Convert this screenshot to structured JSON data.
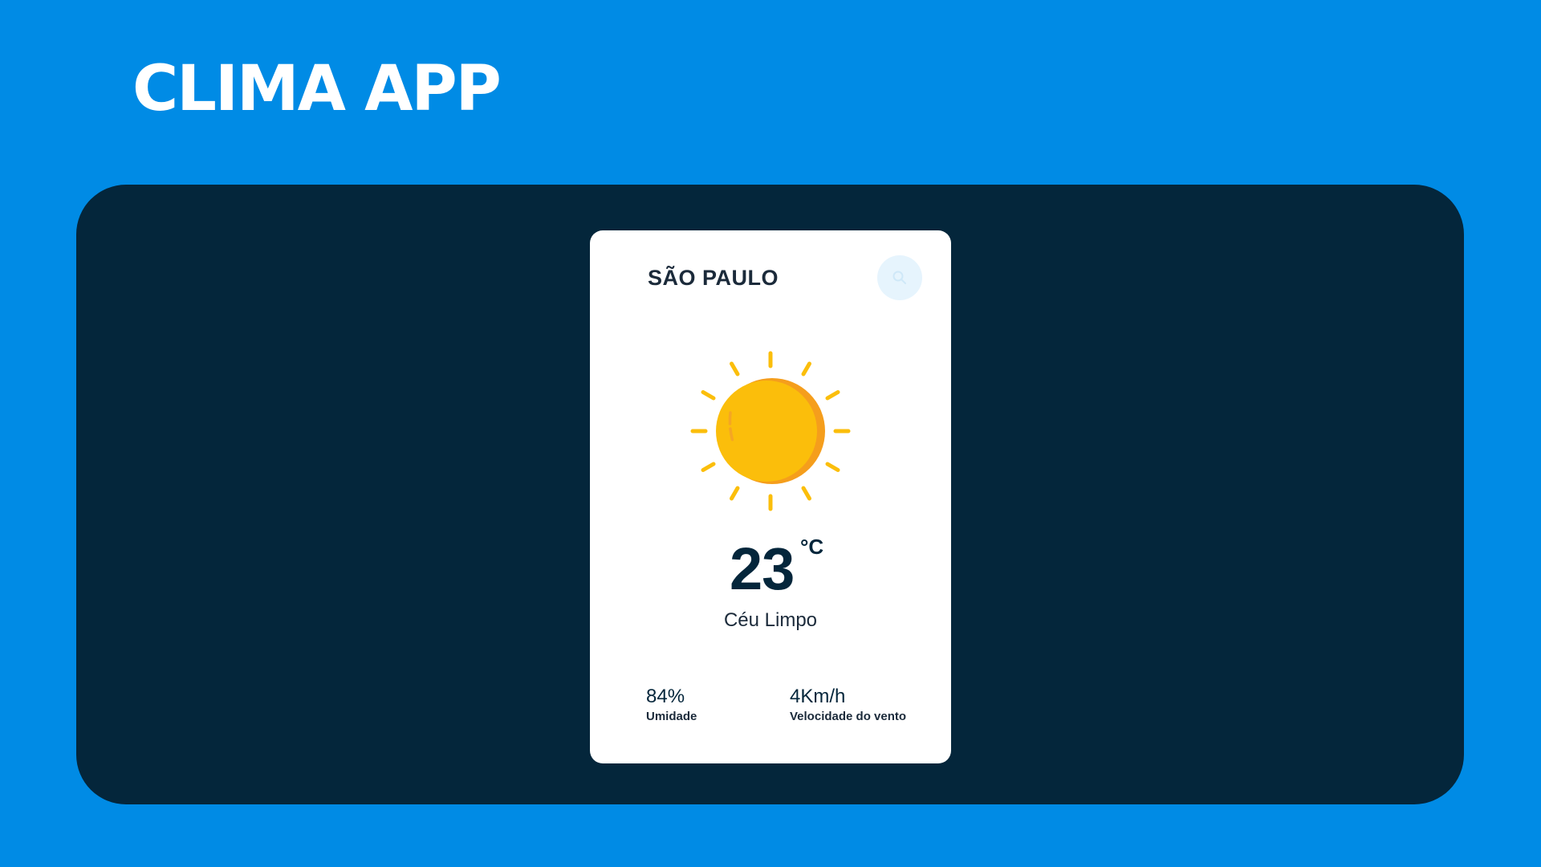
{
  "app": {
    "title": "CLIMA APP"
  },
  "weather_card": {
    "city": "SÃO PAULO",
    "search_icon": "search-icon",
    "condition_icon": "sun-icon",
    "temperature": "23",
    "temperature_unit": "°C",
    "condition": "Céu Limpo",
    "humidity": {
      "value": "84%",
      "label": "Umidade"
    },
    "wind": {
      "value": "4Km/h",
      "label": "Velocidade do vento"
    }
  },
  "colors": {
    "background": "#008BE5",
    "stage": "#04263B",
    "card": "#FFFFFF",
    "sun": "#FBBE0B",
    "sun_shadow": "#F59E1C",
    "text_dark": "#04263B",
    "search_button": "#E6F4FD"
  }
}
